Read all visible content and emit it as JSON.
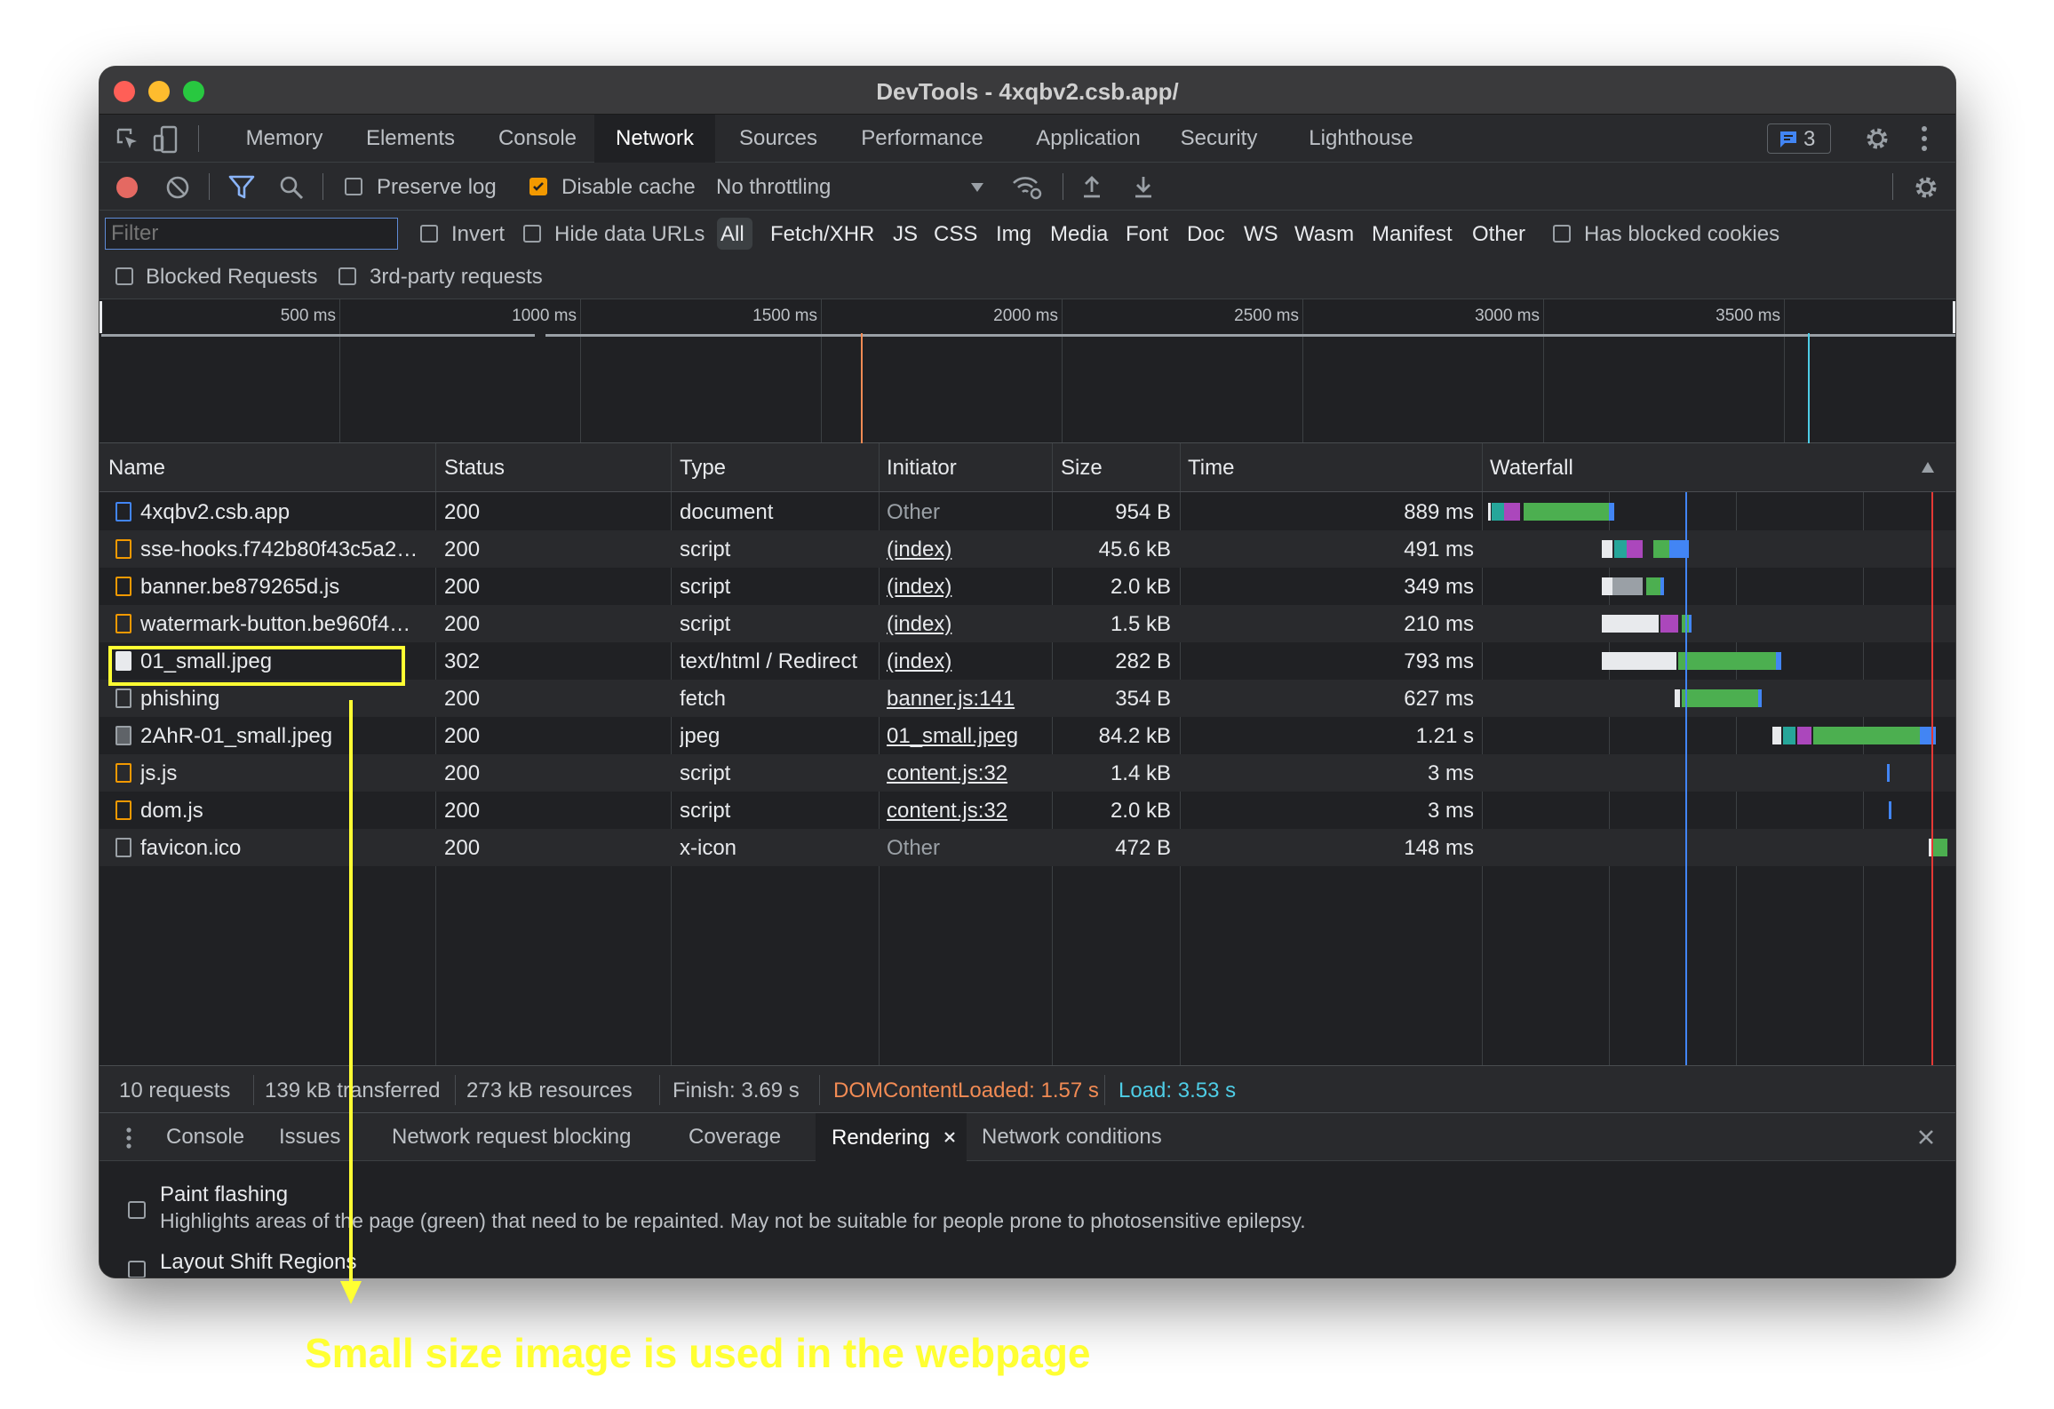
{
  "window": {
    "title": "DevTools - 4xqbv2.csb.app/"
  },
  "tabs": [
    "Memory",
    "Elements",
    "Console",
    "Network",
    "Sources",
    "Performance",
    "Application",
    "Security",
    "Lighthouse"
  ],
  "active_tab": "Network",
  "issues_badge": "3",
  "toolbar": {
    "preserve_log": "Preserve log",
    "disable_cache": "Disable cache",
    "throttling": "No throttling"
  },
  "filter": {
    "placeholder": "Filter",
    "invert": "Invert",
    "hide_data_urls": "Hide data URLs",
    "types": [
      "All",
      "Fetch/XHR",
      "JS",
      "CSS",
      "Img",
      "Media",
      "Font",
      "Doc",
      "WS",
      "Wasm",
      "Manifest",
      "Other"
    ],
    "has_blocked_cookies": "Has blocked cookies",
    "blocked_requests": "Blocked Requests",
    "third_party": "3rd-party requests"
  },
  "overview": {
    "ticks": [
      "500 ms",
      "1000 ms",
      "1500 ms",
      "2000 ms",
      "2500 ms",
      "3000 ms",
      "3500 ms"
    ]
  },
  "columns": {
    "name": "Name",
    "status": "Status",
    "type": "Type",
    "initiator": "Initiator",
    "size": "Size",
    "time": "Time",
    "waterfall": "Waterfall"
  },
  "requests": [
    {
      "name": "4xqbv2.csb.app",
      "status": "200",
      "type": "document",
      "initiator": "Other",
      "size": "954 B",
      "time": "889 ms",
      "icon": "doc"
    },
    {
      "name": "sse-hooks.f742b80f43c5a2…",
      "status": "200",
      "type": "script",
      "initiator": "(index)",
      "size": "45.6 kB",
      "time": "491 ms",
      "icon": "script"
    },
    {
      "name": "banner.be879265d.js",
      "status": "200",
      "type": "script",
      "initiator": "(index)",
      "size": "2.0 kB",
      "time": "349 ms",
      "icon": "script"
    },
    {
      "name": "watermark-button.be960f4…",
      "status": "200",
      "type": "script",
      "initiator": "(index)",
      "size": "1.5 kB",
      "time": "210 ms",
      "icon": "script"
    },
    {
      "name": "01_small.jpeg",
      "status": "302",
      "type": "text/html / Redirect",
      "initiator": "(index)",
      "size": "282 B",
      "time": "793 ms",
      "icon": "white"
    },
    {
      "name": "phishing",
      "status": "200",
      "type": "fetch",
      "initiator": "banner.js:141",
      "size": "354 B",
      "time": "627 ms",
      "icon": "blank"
    },
    {
      "name": "2AhR-01_small.jpeg",
      "status": "200",
      "type": "jpeg",
      "initiator": "01_small.jpeg",
      "size": "84.2 kB",
      "time": "1.21 s",
      "icon": "img"
    },
    {
      "name": "js.js",
      "status": "200",
      "type": "script",
      "initiator": "content.js:32",
      "size": "1.4 kB",
      "time": "3 ms",
      "icon": "script"
    },
    {
      "name": "dom.js",
      "status": "200",
      "type": "script",
      "initiator": "content.js:32",
      "size": "2.0 kB",
      "time": "3 ms",
      "icon": "script"
    },
    {
      "name": "favicon.ico",
      "status": "200",
      "type": "x-icon",
      "initiator": "Other",
      "size": "472 B",
      "time": "148 ms",
      "icon": "blank"
    }
  ],
  "status_bar": {
    "requests": "10 requests",
    "transferred": "139 kB transferred",
    "resources": "273 kB resources",
    "finish": "Finish: 3.69 s",
    "dom_content_loaded": "DOMContentLoaded: 1.57 s",
    "load": "Load: 3.53 s"
  },
  "drawer": {
    "tabs": [
      "Console",
      "Issues",
      "Network request blocking",
      "Coverage",
      "Rendering",
      "Network conditions"
    ],
    "active": "Rendering",
    "paint_flashing": {
      "label": "Paint flashing",
      "description": "Highlights areas of the page (green) that need to be repainted. May not be suitable for people prone to photosensitive epilepsy."
    },
    "layout_shift": "Layout Shift Regions"
  },
  "annotation": "Small size image is used in the webpage",
  "colors": {
    "accent": "#f29900",
    "dcl": "#f28b54",
    "load": "#4ecde6",
    "annotation": "#ffff33"
  }
}
